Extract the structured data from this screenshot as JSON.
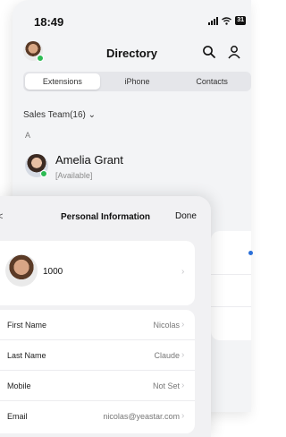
{
  "status_bar": {
    "time": "18:49",
    "battery": "31"
  },
  "directory": {
    "title": "Directory",
    "tabs": [
      {
        "label": "Extensions",
        "active": true
      },
      {
        "label": "iPhone",
        "active": false
      },
      {
        "label": "Contacts",
        "active": false
      }
    ],
    "group_label": "Sales Team(16) ⌄",
    "section_letter": "A",
    "contacts": [
      {
        "name": "Amelia Grant",
        "status": "[Available]"
      }
    ]
  },
  "personal_info": {
    "title": "Personal Information",
    "back": "<",
    "done": "Done",
    "extension": "1000",
    "fields": [
      {
        "label": "First Name",
        "value": "Nicolas"
      },
      {
        "label": "Last Name",
        "value": "Claude"
      },
      {
        "label": "Mobile",
        "value": "Not Set"
      },
      {
        "label": "Email",
        "value": "nicolas@yeastar.com"
      }
    ]
  },
  "colors": {
    "presence_green": "#2dbb54",
    "accent_blue": "#2a6fd8"
  },
  "icons": [
    "search-icon",
    "person-icon",
    "chevron-right-icon",
    "presence-dot-icon"
  ]
}
